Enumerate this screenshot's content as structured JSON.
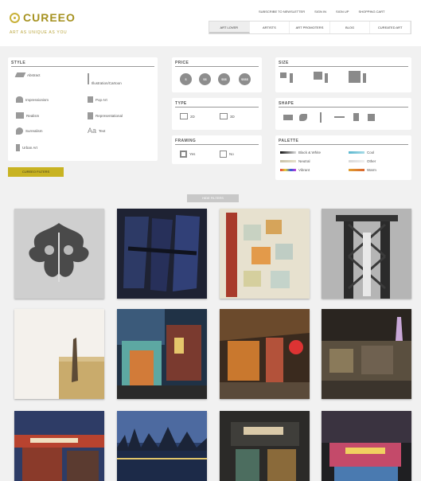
{
  "header": {
    "logo_text": "CUREEO",
    "tagline": "ART AS UNIQUE AS YOU",
    "top_links": [
      "SUBSCRIBE TO NEWSLETTER",
      "SIGN IN",
      "SIGN UP",
      "SHOPPING CART"
    ],
    "nav_tabs": [
      "ART LOVER",
      "ARTISTS",
      "ART PROMOTERS",
      "BLOG",
      "CUREATED ART"
    ],
    "active_tab_index": 0
  },
  "style_panel": {
    "title": "STYLE",
    "options": [
      "Abstract",
      "Illustration/Cartoon",
      "Impressionism",
      "Pop Art",
      "Realism",
      "Representational",
      "Surrealism",
      "Text",
      "Urban Art"
    ],
    "button_label": "CUREEO FILTERS"
  },
  "price_panel": {
    "title": "PRICE",
    "circles": [
      "$",
      "$$",
      "$$$",
      "$$$$"
    ]
  },
  "type_panel": {
    "title": "TYPE",
    "options": [
      "2D",
      "3D"
    ]
  },
  "framing_panel": {
    "title": "FRAMING",
    "options": [
      "Yes",
      "No"
    ]
  },
  "size_panel": {
    "title": "SIZE"
  },
  "shape_panel": {
    "title": "SHAPE"
  },
  "palette_panel": {
    "title": "PALETTE",
    "options": [
      {
        "label": "Black & White",
        "colors": [
          "#111111",
          "#dddddd"
        ]
      },
      {
        "label": "Cool",
        "colors": [
          "#5ab7cf",
          "#a7dbe6"
        ]
      },
      {
        "label": "Neutral",
        "colors": [
          "#c9c2a8",
          "#e5e0cc"
        ]
      },
      {
        "label": "Other",
        "colors": [
          "#d8d8d8",
          "#efefef"
        ]
      },
      {
        "label": "Vibrant",
        "colors": [
          "#e53b3b",
          "#2d5bd8"
        ]
      },
      {
        "label": "Warm",
        "colors": [
          "#e0a032",
          "#d9642d"
        ]
      }
    ]
  },
  "hide_filters_label": "HIDE FILTERS",
  "colors": {
    "brand": "#c8b322",
    "panel": "#ffffff",
    "background": "#f1f1f1"
  }
}
